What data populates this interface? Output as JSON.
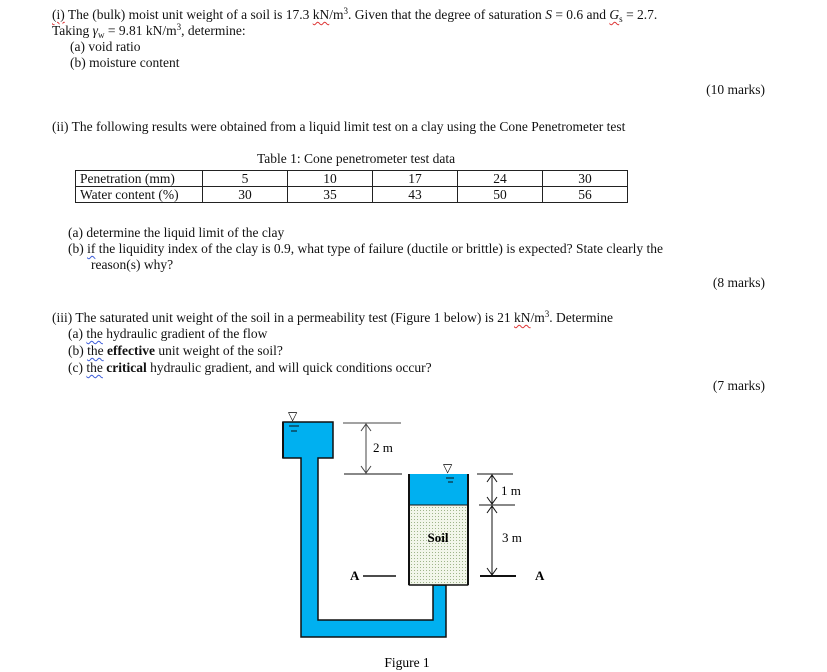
{
  "q1": {
    "num": "(i)",
    "line1_pre": " The (bulk) moist unit weight of a soil is 17.3 ",
    "unit1": "kN",
    "unit1_rest": "/m",
    "exp": "3",
    "line1_mid": ". Given that the degree of saturation ",
    "S_sym": "S",
    "S_eq": " = 0.6 and ",
    "G_sym": "G",
    "G_sub": "s",
    "G_eq": " = 2.7.",
    "line2_pre": "Taking ",
    "gamma": "γ",
    "gamma_sub": "w",
    "line2_rest": " = 9.81 kN/m",
    "line2_end": ", determine:",
    "items": [
      "(a) void ratio",
      "(b) moisture content"
    ],
    "marks": "(10 marks)"
  },
  "q2": {
    "intro": "(ii) The following results were obtained from a liquid limit test on a clay using the Cone Penetrometer test",
    "table": {
      "caption": "Table 1: Cone penetrometer test data",
      "rows": [
        {
          "label": "Penetration (mm)",
          "values": [
            "5",
            "10",
            "17",
            "24",
            "30"
          ]
        },
        {
          "label": "Water content (%)",
          "values": [
            "30",
            "35",
            "43",
            "50",
            "56"
          ]
        }
      ]
    },
    "item_a": "(a) determine the liquid limit of the clay",
    "item_b_label": "(b) ",
    "item_b_if": "if",
    "item_b_rest": " the liquidity index of the clay is 0.9, what type of failure (ductile or brittle) is expected? State clearly the",
    "item_b_cont": "reason(s) why?",
    "marks": "(8 marks)"
  },
  "q3": {
    "intro_pre": "(iii) The saturated unit weight of the soil in a permeability test (Figure 1 below) is 21 ",
    "unit": "kN",
    "unit_rest": "/m",
    "exp": "3",
    "intro_end": ". Determine",
    "item_a_label": "(a) ",
    "item_a_the": "the",
    "item_a_rest": " hydraulic gradient of the flow",
    "item_b_label": "(b) ",
    "item_b_the": "the",
    "item_b_bold": "effective",
    "item_b_rest": " unit weight of the soil?",
    "item_c_label": "(c) ",
    "item_c_the": "the",
    "item_c_bold": "critical",
    "item_c_rest": " hydraulic gradient, and will quick conditions occur?",
    "marks": "(7 marks)"
  },
  "figure": {
    "caption": "Figure 1",
    "dim_top": "2 m",
    "dim_water": "1 m",
    "dim_soil": "3 m",
    "soil_label": "Soil",
    "datum_left": "A",
    "datum_right": "A",
    "water_symbol": "▽",
    "colors": {
      "water": "#00b0f0",
      "soil": "#e8f0dc",
      "line": "#111111"
    }
  }
}
